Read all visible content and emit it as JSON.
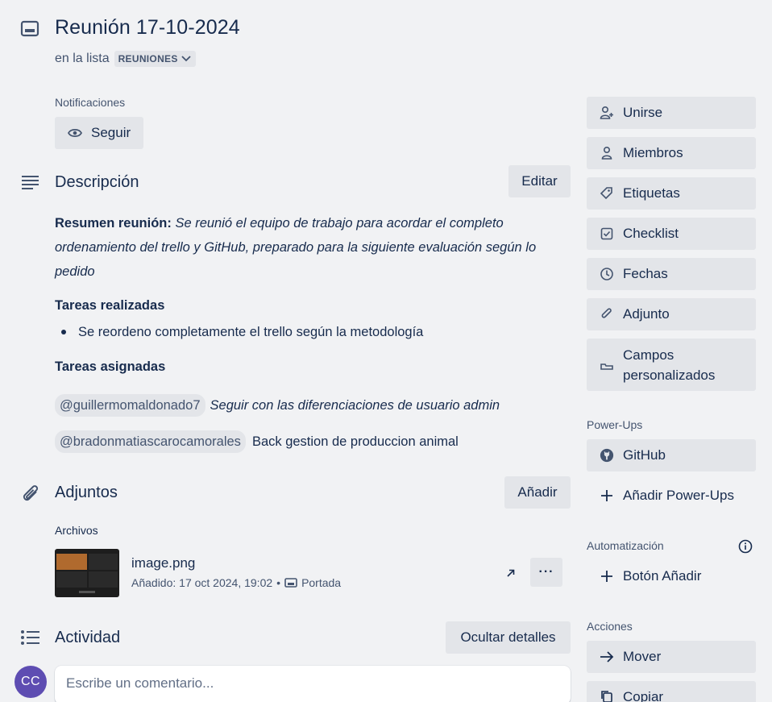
{
  "card": {
    "title": "Reunión 17-10-2024",
    "list_prefix": "en la lista",
    "list_name": "REUNIONES"
  },
  "notifications": {
    "label": "Notificaciones",
    "follow_label": "Seguir"
  },
  "description": {
    "title": "Descripción",
    "edit_label": "Editar",
    "summary_bold": "Resumen reunión:",
    "summary_text": " Se reunió el equipo de trabajo para acordar el completo ordenamiento del trello y GitHub, preparado para la siguiente evaluación según lo pedido",
    "done_heading": "Tareas realizadas",
    "done_items": [
      "Se reordeno completamente el trello según la metodología"
    ],
    "assigned_heading": "Tareas asignadas",
    "assigned": [
      {
        "mention": "@guillermomaldonado7",
        "text": "Seguir con las diferenciaciones de usuario admin",
        "italic": true
      },
      {
        "mention": "@bradonmatiascarocamorales",
        "text": "Back gestion de produccion animal",
        "italic": false
      }
    ]
  },
  "attachments": {
    "title": "Adjuntos",
    "add_label": "Añadir",
    "files_label": "Archivos",
    "file": {
      "name": "image.png",
      "added": "Añadido: 17 oct 2024, 19:02",
      "separator": "•",
      "cover_label": "Portada",
      "menu_label": "···"
    }
  },
  "activity": {
    "title": "Actividad",
    "hide_details_label": "Ocultar detalles",
    "avatar_initials": "CC",
    "comment_placeholder": "Escribe un comentario..."
  },
  "sidebar": {
    "actions": [
      {
        "label": "Unirse",
        "icon": "add-person-icon"
      },
      {
        "label": "Miembros",
        "icon": "person-icon"
      },
      {
        "label": "Etiquetas",
        "icon": "tag-icon"
      },
      {
        "label": "Checklist",
        "icon": "checkbox-icon"
      },
      {
        "label": "Fechas",
        "icon": "clock-icon"
      },
      {
        "label": "Adjunto",
        "icon": "paperclip-icon"
      },
      {
        "label": "Campos personalizados",
        "icon": "custom-fields-icon"
      }
    ],
    "powerups_heading": "Power-Ups",
    "github_label": "GitHub",
    "add_powerups_label": "Añadir Power-Ups",
    "automation_heading": "Automatización",
    "add_button_label": "Botón Añadir",
    "actions_heading": "Acciones",
    "move_label": "Mover",
    "copy_label": "Copiar"
  },
  "colors": {
    "background": "#f1f2f4",
    "button": "#e3e5e9",
    "text": "#172b4d",
    "subtle": "#44546f",
    "avatar": "#5e4db2"
  }
}
